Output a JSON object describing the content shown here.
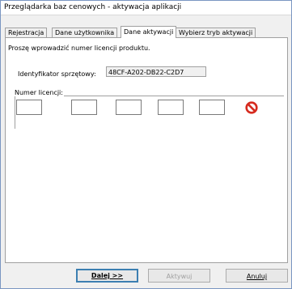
{
  "window": {
    "title": "Przeglądarka baz cenowych - aktywacja aplikacji"
  },
  "tabs": [
    {
      "label": "Rejestracja"
    },
    {
      "label": "Dane użytkownika"
    },
    {
      "label": "Dane aktywacji",
      "active": true
    },
    {
      "label": "Wybierz tryb aktywacji"
    }
  ],
  "panel": {
    "instruction": "Proszę wprowadzić numer licencji produktu.",
    "hardware_id_label": "Identyfikator sprzętowy:",
    "hardware_id_value": "48CF-A202-DB22-C2D7",
    "license_group_label": "Numer licencji:",
    "license_fields": [
      "",
      "",
      "",
      "",
      ""
    ],
    "clear_icon": "no-entry-icon"
  },
  "buttons": {
    "next": "Dalej >>",
    "activate": "Aktywuj",
    "cancel": "Anuluj"
  },
  "colors": {
    "accent": "#3c7fb1",
    "clear_icon": "#d62b1f"
  }
}
